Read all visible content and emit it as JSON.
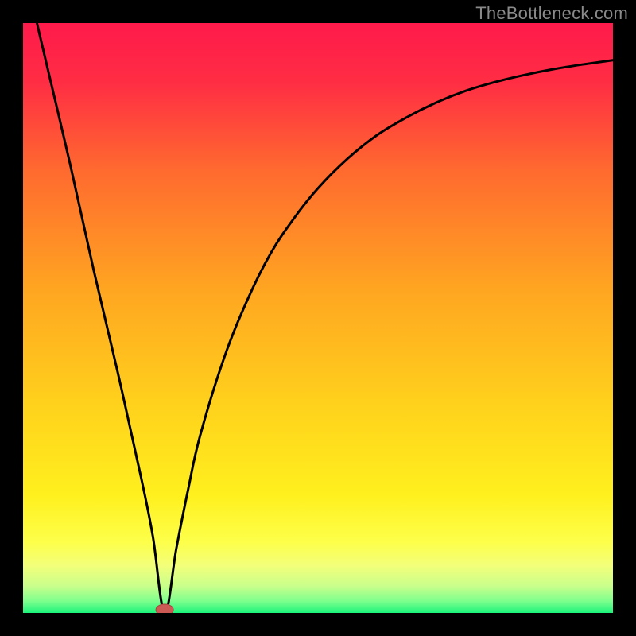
{
  "attribution": "TheBottleneck.com",
  "chart_data": {
    "type": "line",
    "title": "",
    "xlabel": "",
    "ylabel": "",
    "xlim": [
      0,
      100
    ],
    "ylim": [
      0,
      100
    ],
    "grid": false,
    "legend": false,
    "minimum_marker": {
      "x": 24,
      "y": 0
    },
    "series": [
      {
        "name": "bottleneck-curve",
        "x": [
          0,
          4,
          8,
          12,
          16,
          20,
          22,
          24,
          26,
          28,
          30,
          34,
          38,
          42,
          46,
          50,
          55,
          60,
          65,
          70,
          75,
          80,
          85,
          90,
          95,
          100
        ],
        "values": [
          110,
          93,
          76,
          58,
          41,
          23,
          13,
          0,
          11,
          21,
          30,
          43,
          53,
          61,
          67,
          72,
          77,
          81,
          84,
          86.5,
          88.5,
          90,
          91.2,
          92.2,
          93,
          93.7
        ]
      }
    ],
    "background_gradient_stops": [
      {
        "offset": 0.0,
        "color": "#ff1a4b"
      },
      {
        "offset": 0.1,
        "color": "#ff2d44"
      },
      {
        "offset": 0.25,
        "color": "#ff6a2f"
      },
      {
        "offset": 0.45,
        "color": "#ffa521"
      },
      {
        "offset": 0.65,
        "color": "#ffd21c"
      },
      {
        "offset": 0.8,
        "color": "#fff01e"
      },
      {
        "offset": 0.88,
        "color": "#fdff4a"
      },
      {
        "offset": 0.92,
        "color": "#f3ff7a"
      },
      {
        "offset": 0.955,
        "color": "#c8ff8c"
      },
      {
        "offset": 0.98,
        "color": "#7dff8d"
      },
      {
        "offset": 1.0,
        "color": "#1bf47a"
      }
    ]
  }
}
